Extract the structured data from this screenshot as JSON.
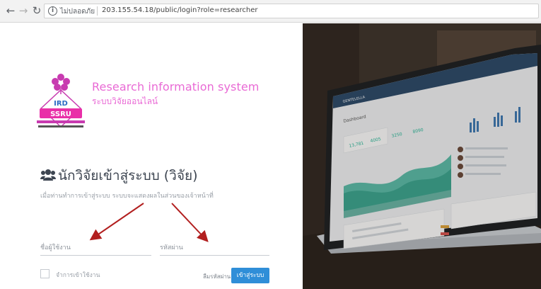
{
  "browser": {
    "security_label": "ไม่ปลอดภัย",
    "url": "203.155.54.18/public/login?role=researcher",
    "back_icon": "arrow-left-icon",
    "forward_icon": "arrow-right-icon",
    "reload_icon": "reload-icon",
    "info_icon": "info-icon"
  },
  "brand": {
    "name_en": "Research information system",
    "name_th": "ระบบวิจัยออนไลน์",
    "color": "#e96ad5",
    "logo_text": "IRD"
  },
  "login": {
    "heading": "นักวิจัยเข้าสู่ระบบ (วิจัย)",
    "heading_icon": "users-icon",
    "subtitle": "เมื่อท่านทำการเข้าสู่ระบบ ระบบจะแสดงผลในส่วนของเจ้าหน้าที่",
    "username_placeholder": "ชื่อผู้ใช้งาน",
    "username_value": "",
    "password_placeholder": "รหัสผ่าน",
    "password_value": "",
    "remember_label": "จำการเข้าใช้งาน",
    "forgot_label": "ลืมรหัสผ่าน?",
    "submit_label": "เข้าสู่ระบบ",
    "submit_color": "#2f8ed8"
  },
  "hero": {
    "description": "laptop-dashboard-photo",
    "dashboard_title": "Dashboard"
  }
}
